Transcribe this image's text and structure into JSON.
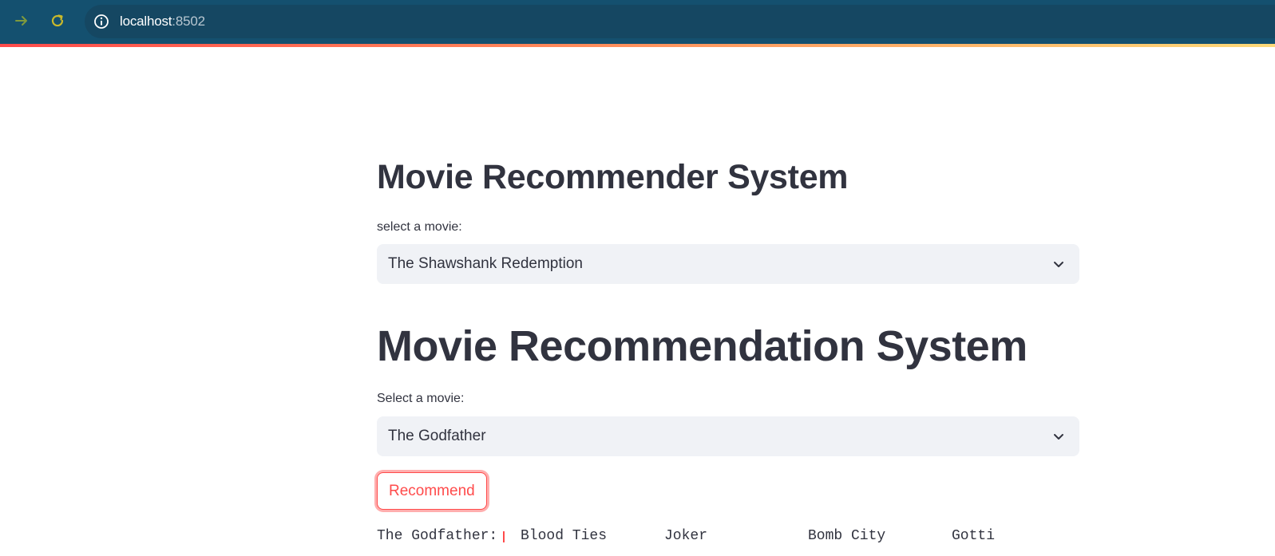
{
  "browser": {
    "url_host": "localhost",
    "url_port": ":8502",
    "icons": {
      "forward": "arrow-right-icon",
      "reload": "reload-icon",
      "info": "info-icon"
    }
  },
  "app": {
    "title_primary": "Movie Recommender System",
    "select_primary": {
      "label": "select a movie:",
      "value": "The Shawshank Redemption"
    },
    "title_secondary": "Movie Recommendation System",
    "select_secondary": {
      "label": "Select a movie:",
      "value": "The Godfather"
    },
    "recommend_button": "Recommend",
    "results": [
      "The Godfather:",
      "Blood Ties",
      "Joker",
      "Bomb City",
      "Gotti"
    ]
  },
  "colors": {
    "chrome_bg": "#14506f",
    "accent": "#ff4b4b",
    "select_bg": "#f0f2f6",
    "text": "#31333f"
  }
}
